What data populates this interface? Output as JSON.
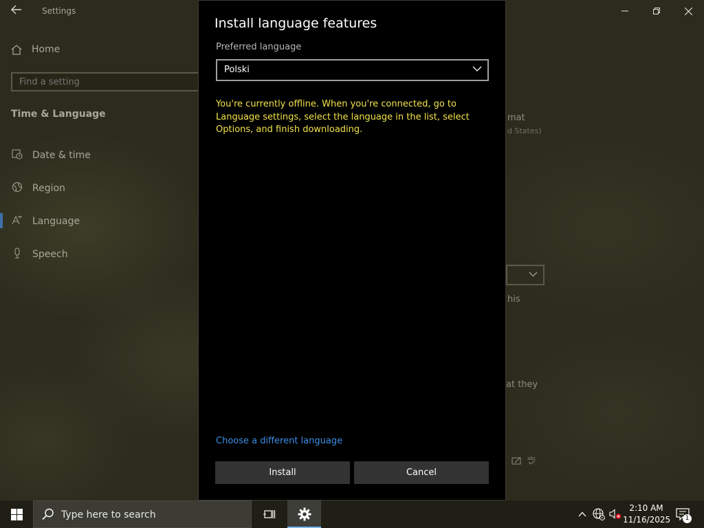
{
  "settings_window": {
    "title": "Settings",
    "home_label": "Home",
    "search_placeholder": "Find a setting",
    "section_title": "Time & Language",
    "nav_items": [
      {
        "label": "Date & time",
        "icon": "calendar-clock-icon"
      },
      {
        "label": "Region",
        "icon": "globe-icon"
      },
      {
        "label": "Language",
        "icon": "language-icon",
        "active": true
      },
      {
        "label": "Speech",
        "icon": "microphone-icon"
      }
    ],
    "right_fragments": {
      "format": "mat",
      "format_sub": "d States)",
      "this_text": "his",
      "they_text": "at they"
    }
  },
  "dialog": {
    "title": "Install language features",
    "preferred_label": "Preferred language",
    "selected_language": "Polski",
    "offline_warning": "You're currently offline. When you're connected, go to Language settings, select the language in the list, select Options, and finish downloading.",
    "change_link": "Choose a different language",
    "install_label": "Install",
    "cancel_label": "Cancel"
  },
  "taskbar": {
    "search_text": "Type here to search",
    "time": "2:10 AM",
    "date": "11/16/2025",
    "notification_count": "1"
  },
  "colors": {
    "warning_text": "#f2e34a",
    "link": "#3d8ee6",
    "accent": "#76b9ed"
  }
}
